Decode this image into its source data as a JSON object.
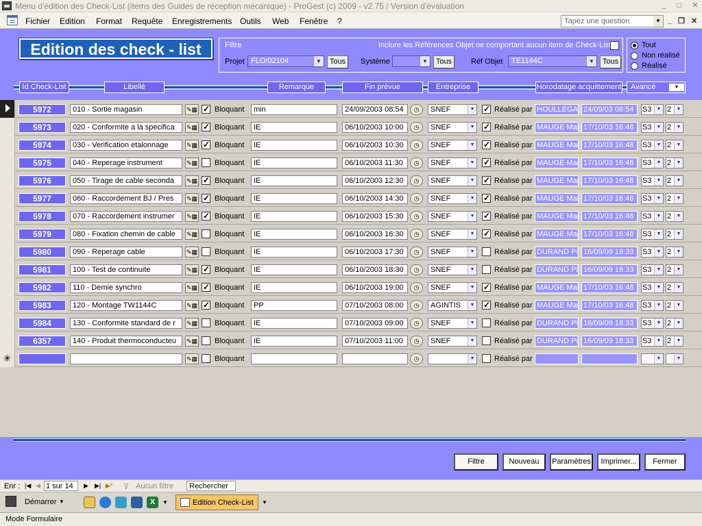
{
  "window": {
    "title": "Menu d'édition des Check-List (items des Guides de réception mécanique) - ProGest (c) 2009 - v2.75 / Version d'évaluation"
  },
  "menu": {
    "items": [
      "Fichier",
      "Edition",
      "Format",
      "Requête",
      "Enregistrements",
      "Outils",
      "Web",
      "Fenêtre",
      "?"
    ],
    "question_placeholder": "Tapez une question"
  },
  "form": {
    "title": "Edition des check - list",
    "filter": {
      "legend": "Filtre",
      "include_label": "Inclure les Références Objet ne comportant aucun item de Check-List",
      "projet_label": "Projet",
      "projet_value": "FLO/02104",
      "systeme_label": "Système",
      "systeme_value": "",
      "refobjet_label": "Réf Objet",
      "refobjet_value": "TE1144C",
      "tous_label": "Tous"
    },
    "radio": [
      "Tout",
      "Non réalisé",
      "Réalisé"
    ],
    "columns": {
      "id": "Id Check-List",
      "libelle": "Libellé",
      "remarque": "Remarque",
      "fin_prevue": "Fin prévue",
      "entreprise": "Entreprise",
      "horodatage": "Horodatage acquittement",
      "avance": "Avancé"
    },
    "bloquant_label": "Bloquant",
    "realise_label": "Réalisé par"
  },
  "rows": [
    {
      "id": "5972",
      "libelle": "010 - Sortie magasin",
      "bloquant": true,
      "remarque": "min",
      "fin": "24/09/2003 08:54",
      "entreprise": "SNEF",
      "realise": true,
      "par": "HOULLEGAT",
      "horodatage": "24/09/03 08:54",
      "s": "S3",
      "n": "2"
    },
    {
      "id": "5973",
      "libelle": "020 - Conformite a la specifica",
      "bloquant": true,
      "remarque": "IE",
      "fin": "06/10/2003 10:00",
      "entreprise": "SNEF",
      "realise": true,
      "par": "MAUGE Mar",
      "horodatage": "17/10/03 16:48",
      "s": "S3",
      "n": "2"
    },
    {
      "id": "5974",
      "libelle": "030 - Verification etalonnage",
      "bloquant": true,
      "remarque": "IE",
      "fin": "06/10/2003 10:30",
      "entreprise": "SNEF",
      "realise": true,
      "par": "MAUGE Mar",
      "horodatage": "17/10/03 16:48",
      "s": "S3",
      "n": "2"
    },
    {
      "id": "5975",
      "libelle": "040 - Reperage instrument",
      "bloquant": false,
      "remarque": "IE",
      "fin": "06/10/2003 11:30",
      "entreprise": "SNEF",
      "realise": true,
      "par": "MAUGE Mar",
      "horodatage": "17/10/03 16:48",
      "s": "S3",
      "n": "2"
    },
    {
      "id": "5976",
      "libelle": "050 - Tirage de cable seconda",
      "bloquant": true,
      "remarque": "IE",
      "fin": "06/10/2003 12:30",
      "entreprise": "SNEF",
      "realise": true,
      "par": "MAUGE Mar",
      "horodatage": "17/10/03 16:48",
      "s": "S3",
      "n": "2"
    },
    {
      "id": "5977",
      "libelle": "060 - Raccordement BJ / Pres",
      "bloquant": true,
      "remarque": "IE",
      "fin": "06/10/2003 14:30",
      "entreprise": "SNEF",
      "realise": true,
      "par": "MAUGE Mar",
      "horodatage": "17/10/03 16:48",
      "s": "S3",
      "n": "2"
    },
    {
      "id": "5978",
      "libelle": "070 - Raccordement instrumer",
      "bloquant": true,
      "remarque": "IE",
      "fin": "06/10/2003 15:30",
      "entreprise": "SNEF",
      "realise": true,
      "par": "MAUGE Mar",
      "horodatage": "17/10/03 16:48",
      "s": "S3",
      "n": "2"
    },
    {
      "id": "5979",
      "libelle": "080 - Fixation chemin de cable",
      "bloquant": false,
      "remarque": "IE",
      "fin": "06/10/2003 16:30",
      "entreprise": "SNEF",
      "realise": true,
      "par": "MAUGE Mar",
      "horodatage": "17/10/03 16:48",
      "s": "S3",
      "n": "2"
    },
    {
      "id": "5980",
      "libelle": "090 - Reperage cable",
      "bloquant": false,
      "remarque": "IE",
      "fin": "06/10/2003 17:30",
      "entreprise": "SNEF",
      "realise": false,
      "par": "DURAND Pi",
      "horodatage": "16/09/09 18:33",
      "s": "S3",
      "n": "2"
    },
    {
      "id": "5981",
      "libelle": "100 - Test de continuite",
      "bloquant": true,
      "remarque": "IE",
      "fin": "06/10/2003 18:30",
      "entreprise": "SNEF",
      "realise": false,
      "par": "DURAND Pi",
      "horodatage": "16/09/09 18:33",
      "s": "S3",
      "n": "2"
    },
    {
      "id": "5982",
      "libelle": "110 - Demie synchro",
      "bloquant": true,
      "remarque": "IE",
      "fin": "06/10/2003 19:00",
      "entreprise": "SNEF",
      "realise": true,
      "par": "MAUGE Mar",
      "horodatage": "17/10/03 16:48",
      "s": "S3",
      "n": "2"
    },
    {
      "id": "5983",
      "libelle": "120 - Montage TW1144C",
      "bloquant": true,
      "remarque": "PP",
      "fin": "07/10/2003 08:00",
      "entreprise": "AGINTIS",
      "realise": true,
      "par": "MAUGE Mar",
      "horodatage": "17/10/03 16:48",
      "s": "S3",
      "n": "2"
    },
    {
      "id": "5984",
      "libelle": "130 - Conformite standard de r",
      "bloquant": false,
      "remarque": "IE",
      "fin": "07/10/2003 09:00",
      "entreprise": "SNEF",
      "realise": false,
      "par": "DURAND Pi",
      "horodatage": "16/09/09 18:33",
      "s": "S3",
      "n": "2"
    },
    {
      "id": "6357",
      "libelle": "140 - Produit thermoconducteu",
      "bloquant": false,
      "remarque": "IE",
      "fin": "07/10/2003 11:00",
      "entreprise": "SNEF",
      "realise": false,
      "par": "DURAND Pi",
      "horodatage": "16/09/09 18:33",
      "s": "S3",
      "n": "2"
    }
  ],
  "footer": {
    "buttons": [
      "Filtre",
      "Nouveau",
      "Paramètres",
      "Imprimer...",
      "Fermer"
    ]
  },
  "nav": {
    "enr_label": "Enr :",
    "position": "1 sur 14",
    "filter_state": "Aucun filtre",
    "search": "Rechercher"
  },
  "taskbar": {
    "start": "Démarrer",
    "active_window": "Edition Check-List"
  },
  "status": {
    "mode": "Mode Formulaire"
  },
  "colors": {
    "header_bg": "#8f89ff",
    "id_bg": "#6f66f0",
    "title_bg": "#1e61b8",
    "rule": "#1a4fa8"
  }
}
